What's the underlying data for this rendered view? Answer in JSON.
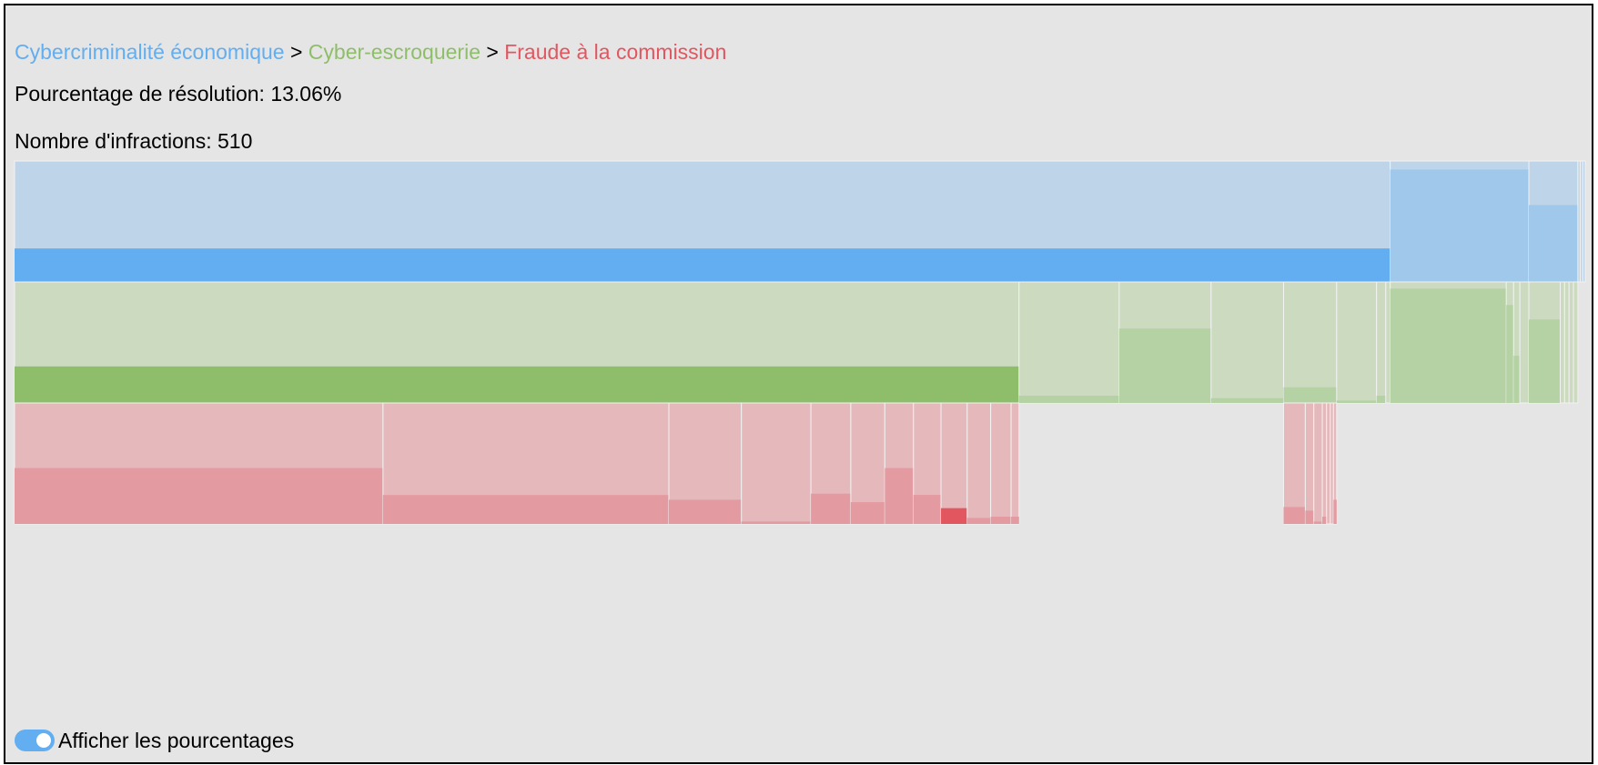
{
  "breadcrumb": {
    "level1": "Cybercriminalité économique",
    "level2": "Cyber-escroquerie",
    "level3": "Fraude à la commission",
    "separator": ">"
  },
  "resolution": {
    "label": "Pourcentage de résolution:",
    "value": "13.06%"
  },
  "offences": {
    "label": "Nombre d'infractions:",
    "value": "510"
  },
  "toggle": {
    "label": "Afficher les pourcentages",
    "on": true
  },
  "colors": {
    "level1": "#62aef0",
    "level2": "#8fbe6a",
    "level3": "#e2565f",
    "level1_fill": "#bdd4e9",
    "level2_fill": "#ccdac0",
    "level3_fill": "#e5b8bb"
  },
  "chart_data": {
    "type": "icicle",
    "note_units": "size = share of parent (0-1), resolved = resolution share (0-1)",
    "levels": [
      {
        "name": "level1",
        "nodes": [
          {
            "size": 0.8758,
            "resolved": 0.277
          },
          {
            "size": 0.0883,
            "resolved": 0.929
          },
          {
            "size": 0.0312,
            "resolved": 0.636
          },
          {
            "size": 0.0015,
            "resolved": 0.0
          },
          {
            "size": 0.0016,
            "resolved": 0.0
          },
          {
            "size": 0.0016,
            "resolved": 0.0
          }
        ]
      },
      {
        "name": "level2",
        "parent_index": 0,
        "nodes": [
          {
            "size": 0.7302,
            "resolved": 0.302
          },
          {
            "size": 0.0728,
            "resolved": 0.06
          },
          {
            "size": 0.0668,
            "resolved": 0.615
          },
          {
            "size": 0.0527,
            "resolved": 0.04
          },
          {
            "size": 0.0386,
            "resolved": 0.13
          },
          {
            "size": 0.029,
            "resolved": 0.02
          },
          {
            "size": 0.0067,
            "resolved": 0.06
          },
          {
            "size": 0.0032,
            "resolved": 0.0
          }
        ],
        "children_of_sibling": [
          {
            "sibling": 1,
            "nodes": [
              {
                "size": 0.837,
                "resolved": 0.945
              },
              {
                "size": 0.053,
                "resolved": 0.81
              },
              {
                "size": 0.045,
                "resolved": 0.39
              },
              {
                "size": 0.065,
                "resolved": 0.0
              }
            ]
          },
          {
            "sibling": 2,
            "nodes": [
              {
                "size": 0.64,
                "resolved": 0.69
              },
              {
                "size": 0.09,
                "resolved": 0.0
              },
              {
                "size": 0.09,
                "resolved": 0.0
              },
              {
                "size": 0.09,
                "resolved": 0.0
              },
              {
                "size": 0.09,
                "resolved": 0.0
              }
            ]
          }
        ]
      },
      {
        "name": "level3",
        "groups": [
          {
            "parent_index": 0,
            "nodes": [
              {
                "size": 0.3668,
                "resolved": 0.462,
                "selected": false
              },
              {
                "size": 0.2846,
                "resolved": 0.239,
                "selected": false
              },
              {
                "size": 0.0722,
                "resolved": 0.2,
                "selected": false
              },
              {
                "size": 0.0692,
                "resolved": 0.02,
                "selected": false
              },
              {
                "size": 0.0397,
                "resolved": 0.25,
                "selected": false
              },
              {
                "size": 0.0339,
                "resolved": 0.18,
                "selected": false
              },
              {
                "size": 0.0285,
                "resolved": 0.462,
                "selected": false
              },
              {
                "size": 0.0274,
                "resolved": 0.24,
                "selected": false
              },
              {
                "size": 0.0261,
                "resolved": 0.1306,
                "selected": true
              },
              {
                "size": 0.0234,
                "resolved": 0.05,
                "selected": false
              },
              {
                "size": 0.0203,
                "resolved": 0.06,
                "selected": false
              },
              {
                "size": 0.0079,
                "resolved": 0.06,
                "selected": false
              }
            ]
          },
          {
            "parent_index": 4,
            "nodes": [
              {
                "size": 0.41,
                "resolved": 0.14
              },
              {
                "size": 0.16,
                "resolved": 0.11
              },
              {
                "size": 0.16,
                "resolved": 0.02
              },
              {
                "size": 0.08,
                "resolved": 0.06
              },
              {
                "size": 0.07,
                "resolved": 0.0
              },
              {
                "size": 0.06,
                "resolved": 0.0
              },
              {
                "size": 0.06,
                "resolved": 0.2
              }
            ]
          }
        ]
      }
    ]
  }
}
